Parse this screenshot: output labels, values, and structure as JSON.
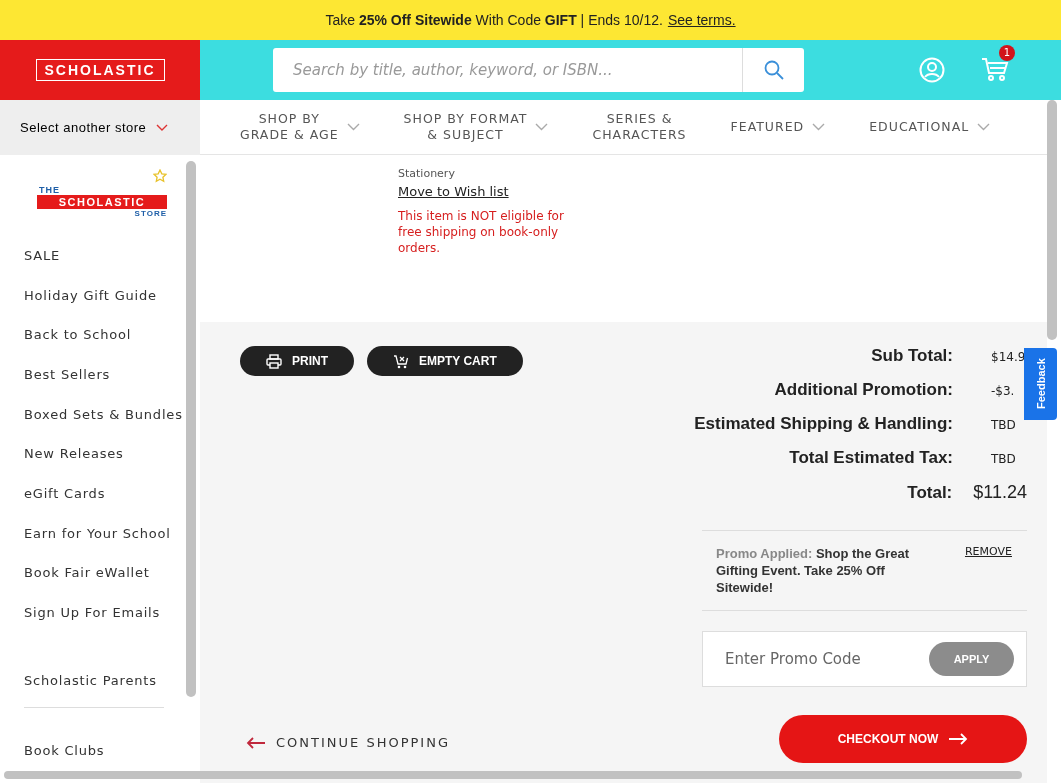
{
  "promo_bar": {
    "text": "Take **25% Off Sitewide** With Code **GIFT** | Ends 10/12.",
    "link": "See terms."
  },
  "header": {
    "logo": "SCHOLASTIC",
    "search": {
      "placeholder": "Search by title, author, keyword, or ISBN..."
    },
    "cart_count": "1"
  },
  "store_selector": {
    "label": "Select another store"
  },
  "nav": [
    {
      "lines": [
        "SHOP BY",
        "GRADE & AGE"
      ],
      "caret": true
    },
    {
      "lines": [
        "SHOP BY FORMAT",
        "& SUBJECT"
      ],
      "caret": true
    },
    {
      "lines": [
        "SERIES &",
        "CHARACTERS"
      ],
      "caret": false
    },
    {
      "lines": [
        "FEATURED"
      ],
      "caret": true
    },
    {
      "lines": [
        "EDUCATIONAL"
      ],
      "caret": true
    }
  ],
  "sidebar": {
    "logo": {
      "top": "THE",
      "middle": "SCHOLASTIC",
      "bottom": "STORE"
    },
    "groups": [
      [
        "SALE",
        "Holiday Gift Guide",
        "Back to School",
        "Best Sellers",
        "Boxed Sets & Bundles",
        "New Releases",
        "eGift Cards",
        "Earn for Your School",
        "Book Fair eWallet",
        "Sign Up For Emails"
      ],
      [
        "Scholastic Parents"
      ],
      [
        "Book Clubs"
      ]
    ]
  },
  "product": {
    "category": "Stationery",
    "wish_link": "Move to Wish list",
    "warning": "This item is NOT eligible for free shipping on book-only orders."
  },
  "actions": [
    {
      "label": "PRINT",
      "kind": "print"
    },
    {
      "label": "EMPTY CART",
      "kind": "empty-cart"
    }
  ],
  "summary": [
    {
      "label": "Sub Total:",
      "value": "$14.9",
      "kind": "line"
    },
    {
      "label": "Additional Promotion:",
      "value": "-$3.",
      "kind": "line"
    },
    {
      "label": "Estimated Shipping & Handling:",
      "value": "TBD",
      "kind": "line"
    },
    {
      "label": "Total Estimated Tax:",
      "value": "TBD",
      "kind": "line"
    },
    {
      "label": "Total:",
      "value": "$11.24",
      "kind": "total"
    }
  ],
  "promo_applied": {
    "text": "Promo Applied: **Shop the Great Gifting Event. Take 25% Off Sitewide!**",
    "remove": "REMOVE"
  },
  "promo_code": {
    "placeholder": "Enter Promo Code",
    "button": "APPLY"
  },
  "continue_shopping": "CONTINUE SHOPPING",
  "checkout": "CHECKOUT NOW",
  "feedback": "Feedback"
}
